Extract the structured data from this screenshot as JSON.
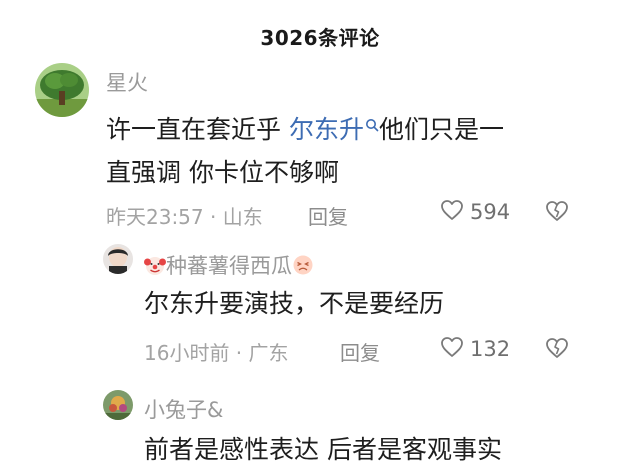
{
  "header": {
    "title": "3026条评论"
  },
  "comments": [
    {
      "name": "星火",
      "text_before": "许一直在套近乎 ",
      "mention": "尔东升",
      "text_after": "他们只是一",
      "text_line2": "直强调 你卡位不够啊",
      "meta": "昨天23:57 · 山东",
      "reply_label": "回复",
      "likes": "594"
    },
    {
      "name": "种蕃薯得西瓜",
      "text": "尔东升要演技，不是要经历",
      "meta": "16小时前 · 广东",
      "reply_label": "回复",
      "likes": "132"
    },
    {
      "name": "小兔子&",
      "text": "前者是感性表达 后者是客观事实"
    }
  ]
}
